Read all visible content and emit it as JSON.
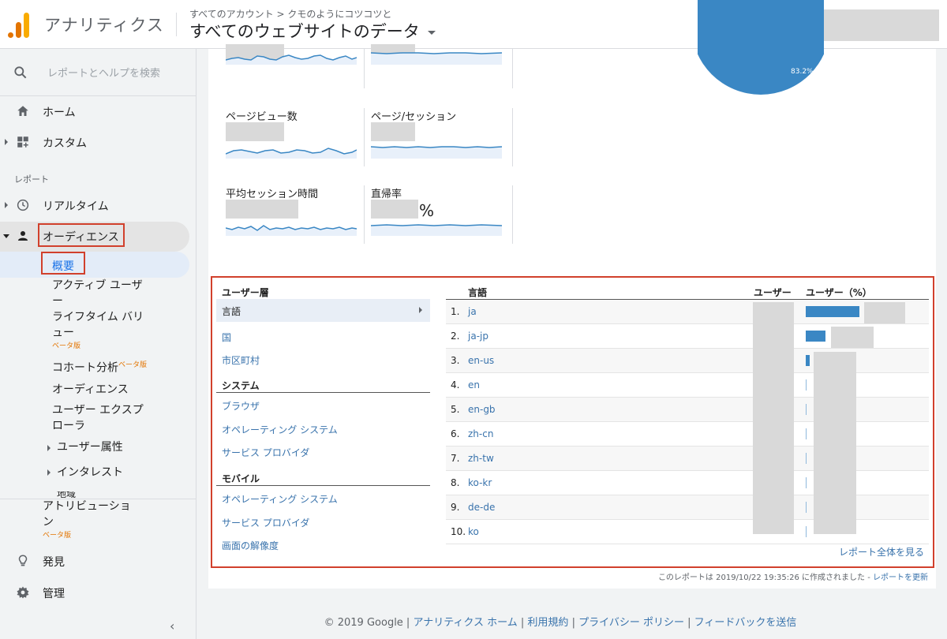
{
  "header": {
    "app_title": "アナリティクス",
    "breadcrumb": "すべてのアカウント > クモのようにコツコツと",
    "view_title": "すべてのウェブサイトのデータ"
  },
  "sidebar": {
    "search_placeholder": "レポートとヘルプを検索",
    "home": "ホーム",
    "custom": "カスタム",
    "section_reports": "レポート",
    "realtime": "リアルタイム",
    "audience": "オーディエンス",
    "overview": "概要",
    "active_users_1": "アクティブ ユーザ",
    "active_users_2": "ー",
    "lifetime_1": "ライフタイム バリ",
    "lifetime_2": "ュー",
    "beta": "ベータ版",
    "cohort": "コホート分析",
    "audiences": "オーディエンス",
    "explorer_1": "ユーザー エクスプ",
    "explorer_2": "ローラ",
    "demographics": "ユーザー属性",
    "interests": "インタレスト",
    "geo": "地域",
    "attribution_1": "アトリビューショ",
    "attribution_2": "ン",
    "discover": "発見",
    "admin": "管理"
  },
  "metrics": {
    "pageviews": "ページビュー数",
    "pages_per_session": "ページ/セッション",
    "avg_session": "平均セッション時間",
    "bounce_rate": "直帰率",
    "percent_sign": "%"
  },
  "pie": {
    "label": "83.2%",
    "value": 83.2,
    "color": "#3a87c4"
  },
  "panel": {
    "left_header": "ユーザー層",
    "language": "言語",
    "country": "国",
    "city": "市区町村",
    "system_header": "システム",
    "browser": "ブラウザ",
    "os": "オペレーティング システム",
    "isp": "サービス プロバイダ",
    "mobile_header": "モバイル",
    "mobile_os": "オペレーティング システム",
    "mobile_isp": "サービス プロバイダ",
    "resolution": "画面の解像度",
    "col_language": "言語",
    "col_users": "ユーザー",
    "col_users_pct": "ユーザー（%）",
    "view_full": "レポート全体を見る",
    "rows": [
      {
        "num": "1.",
        "code": "ja",
        "share": 0.68
      },
      {
        "num": "2.",
        "code": "ja-jp",
        "share": 0.25
      },
      {
        "num": "3.",
        "code": "en-us",
        "share": 0.05
      },
      {
        "num": "4.",
        "code": "en",
        "share": 0.01
      },
      {
        "num": "5.",
        "code": "en-gb",
        "share": 0.01
      },
      {
        "num": "6.",
        "code": "zh-cn",
        "share": 0.01
      },
      {
        "num": "7.",
        "code": "zh-tw",
        "share": 0.01
      },
      {
        "num": "8.",
        "code": "ko-kr",
        "share": 0.01
      },
      {
        "num": "9.",
        "code": "de-de",
        "share": 0.01
      },
      {
        "num": "10.",
        "code": "ko",
        "share": 0.01
      }
    ]
  },
  "report_note": {
    "text": "このレポートは 2019/10/22 19:35:26 に作成されました - ",
    "link": "レポートを更新"
  },
  "footer": {
    "copyright": "© 2019 Google | ",
    "home": "アナリティクス ホーム",
    "sep1": " | ",
    "terms": "利用規約",
    "sep2": " | ",
    "privacy": "プライバシー ポリシー",
    "sep3": " | ",
    "feedback": "フィードバックを送信"
  }
}
